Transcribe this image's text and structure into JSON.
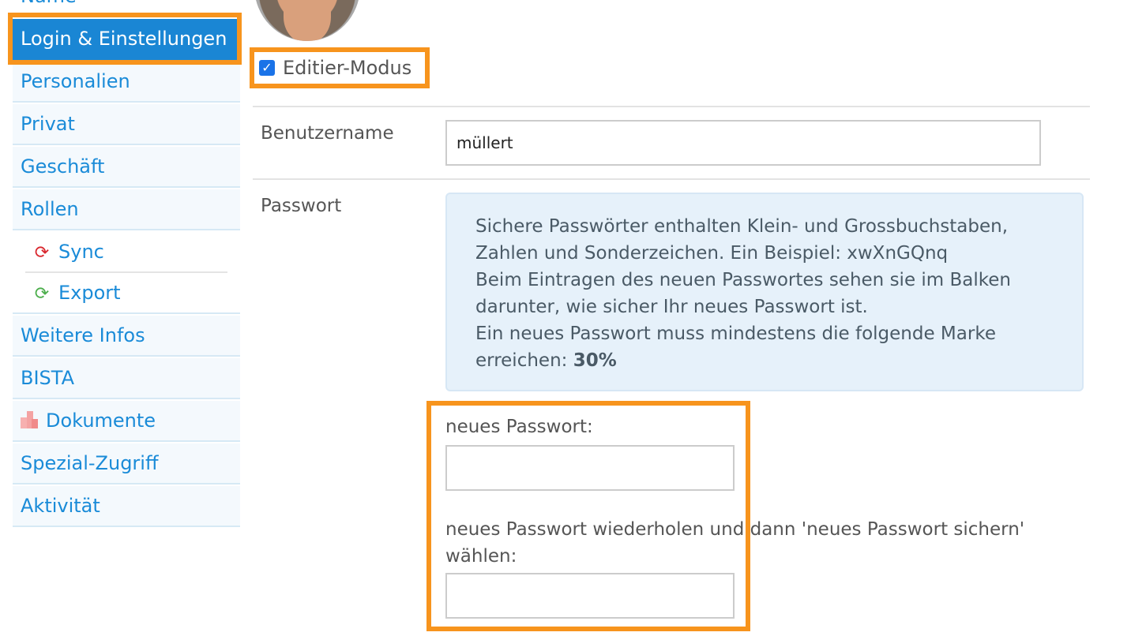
{
  "sidebar": {
    "items": [
      {
        "label": "Name"
      },
      {
        "label": "Login & Einstellungen"
      },
      {
        "label": "Personalien"
      },
      {
        "label": "Privat"
      },
      {
        "label": "Geschäft"
      },
      {
        "label": "Rollen"
      },
      {
        "label": "Sync",
        "icon": "sync-icon"
      },
      {
        "label": "Export",
        "icon": "sync-icon"
      },
      {
        "label": "Weitere Infos"
      },
      {
        "label": "BISTA"
      },
      {
        "label": "Dokumente",
        "icon": "document-icon"
      },
      {
        "label": "Spezial-Zugriff"
      },
      {
        "label": "Aktivität"
      }
    ]
  },
  "main": {
    "edit_mode_label": "Editier-Modus",
    "username_label": "Benutzername",
    "username_value": "müllert",
    "password_label": "Passwort",
    "info": {
      "line1": "Sichere Passwörter enthalten Klein- und Grossbuchstaben,",
      "line2": "Zahlen und Sonderzeichen. Ein Beispiel: xwXnGQnq",
      "line3": "Beim Eintragen des neuen Passwortes sehen sie im Balken",
      "line4": "darunter, wie sicher Ihr neues Passwort ist.",
      "line5": "Ein neues Passwort muss mindestens die folgende Marke",
      "line6_prefix": "erreichen: ",
      "line6_bold": "30%"
    },
    "new_password_label": "neues Passwort:",
    "repeat_password_label_1": "neues Passwort wiederholen und dann 'neues Passwort sichern'",
    "repeat_password_label_2": "wählen:"
  },
  "colors": {
    "accent": "#1a86d4",
    "highlight": "#f7941d",
    "info_bg": "#e6f1fa"
  }
}
